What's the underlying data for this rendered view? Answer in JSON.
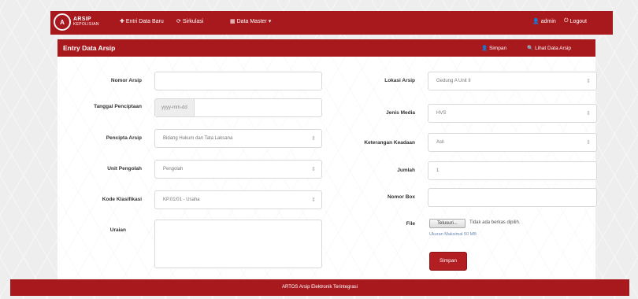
{
  "brand": {
    "logo_text": "A",
    "line1": "ARSIP",
    "line2": "KEPOLISIAN"
  },
  "navbar": {
    "entry": "Entri Data Baru",
    "sirkulasi": "Sirkulasi",
    "master": "Data Master",
    "user": "admin",
    "logout": "Logout"
  },
  "panel": {
    "title": "Entry Data Arsip",
    "save": "Simpan",
    "view": "Lihat Data Arsip"
  },
  "form": {
    "nomor_arsip": {
      "label": "Nomor Arsip",
      "value": ""
    },
    "tanggal": {
      "label": "Tanggal Penciptaan",
      "placeholder": "yyyy-mm-dd"
    },
    "pencipta": {
      "label": "Pencipta Arsip",
      "value": "Bidang Hukum dan Tata Laksana"
    },
    "unit_pengolah": {
      "label": "Unit Pengolah",
      "value": "Pengolah"
    },
    "kode_klasifikasi": {
      "label": "Kode Klasifikasi",
      "value": "KP.01/01 - Usaha"
    },
    "uraian": {
      "label": "Uraian",
      "value": ""
    },
    "lokasi": {
      "label": "Lokasi Arsip",
      "value": "Gedung A Unit II"
    },
    "jenis_media": {
      "label": "Jenis Media",
      "value": "HVS"
    },
    "keterangan": {
      "label": "Keterangan Keadaan",
      "value": "Asli"
    },
    "jumlah": {
      "label": "Jumlah",
      "value": "1"
    },
    "nomor_box": {
      "label": "Nomor Box",
      "value": ""
    },
    "file": {
      "label": "File",
      "button": "Telusuri...",
      "status": "Tidak ada berkas dipilih.",
      "help": "Ukuran Maksimal 50 MB"
    },
    "submit": "Simpan"
  },
  "footer": {
    "text": "ARTOS Arsip Elektronik Terintegrasi"
  },
  "colors": {
    "brand_red": "#a8191e",
    "button_red": "#b31e23"
  }
}
